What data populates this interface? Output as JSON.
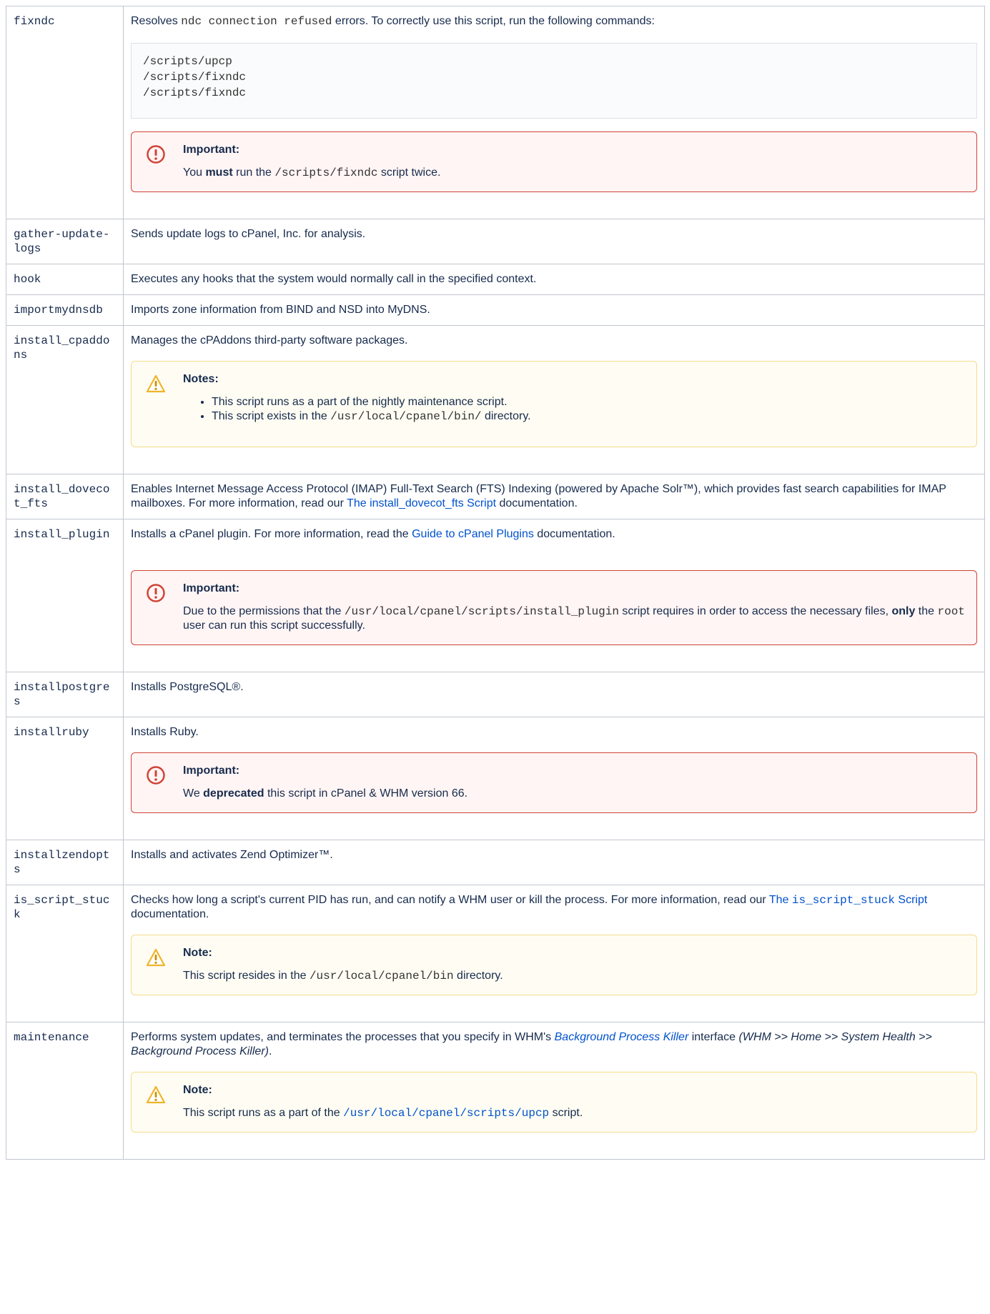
{
  "rows": [
    {
      "name": "fixndc",
      "desc_before": "Resolves ",
      "desc_code": "ndc connection refused",
      "desc_after": " errors. To correctly use this script, run the following commands:",
      "code_block": [
        "/scripts/upcp",
        "/scripts/fixndc",
        "/scripts/fixndc"
      ],
      "macro": {
        "type": "important",
        "icon": "exclamation-circle-icon",
        "title": "Important:",
        "p1": "You ",
        "bold": "must",
        "p2": " run the ",
        "code": "/scripts/fixndc",
        "p3": " script twice."
      }
    },
    {
      "name": "gather-update-logs",
      "desc": "Sends update logs to cPanel, Inc. for analysis."
    },
    {
      "name": "hook",
      "desc": "Executes any hooks that the system would normally call in the specified context."
    },
    {
      "name": "importmydnsdb",
      "desc": "Imports zone information from BIND and NSD into MyDNS."
    },
    {
      "name": "install_cpaddons",
      "desc": "Manages the cPAddons third-party software packages.",
      "macro": {
        "type": "note",
        "icon": "warning-triangle-icon",
        "title": "Notes:",
        "items": [
          {
            "text": "This script runs as a part of the nightly maintenance script."
          },
          {
            "before": "This script exists in the ",
            "code": "/usr/local/cpanel/bin/",
            "after": " directory."
          }
        ]
      }
    },
    {
      "name": "install_dovecot_fts",
      "desc_before": "Enables Internet Message Access Protocol (IMAP) Full-Text Search (FTS) Indexing (powered by Apache Solr™), which provides fast search capabilities for IMAP mailboxes. For more information, read our ",
      "link": "The install_dovecot_fts Script",
      "desc_after": " documentation."
    },
    {
      "name": "install_plugin",
      "desc_before": "Installs a cPanel plugin. For more information, read the ",
      "link": "Guide to cPanel Plugins",
      "desc_after": " documentation.",
      "macro": {
        "type": "important",
        "icon": "exclamation-circle-icon",
        "title": "Important:",
        "p1": "Due to the permissions that the ",
        "code1": "/usr/local/cpanel/scripts/install_plugin",
        "p2": " script requires in order to access the necessary files, ",
        "bold": "only",
        "p3": " the ",
        "code2": "root",
        "p4": " user can run this script successfully."
      }
    },
    {
      "name": "installpostgres",
      "desc": "Installs PostgreSQL®."
    },
    {
      "name": "installruby",
      "desc": "Installs Ruby.",
      "macro": {
        "type": "important",
        "icon": "exclamation-circle-icon",
        "title": "Important:",
        "p1": "We ",
        "bold": "deprecated",
        "p2": " this script in cPanel & WHM version 66."
      }
    },
    {
      "name": "installzendopts",
      "desc": "Installs and activates Zend Optimizer™."
    },
    {
      "name": "is_script_stuck",
      "desc_before": "Checks how long a script's current PID has run, and can notify a WHM user or kill the process. For more information, read our ",
      "link_text": "The ",
      "link_code": "is_script_stuck",
      "link_text2": " Script",
      "desc_after": " documentation.",
      "macro": {
        "type": "note",
        "icon": "warning-triangle-icon",
        "title": "Note:",
        "p1": "This script resides in the ",
        "code": "/usr/local/cpanel/bin",
        "p2": " directory."
      }
    },
    {
      "name": "maintenance",
      "desc_before": "Performs system updates, and terminates the processes that you specify in WHM's ",
      "link": "Background Process Killer",
      "desc_mid": " interface ",
      "desc_em": "(WHM >> Home >> System Health >> Background Process Killer)",
      "desc_after": ".",
      "macro": {
        "type": "note",
        "icon": "warning-triangle-icon",
        "title": "Note:",
        "p1": "This script runs as a part of the ",
        "code": "/usr/local/cpanel/scripts/upcp",
        "p2": " script."
      }
    }
  ]
}
